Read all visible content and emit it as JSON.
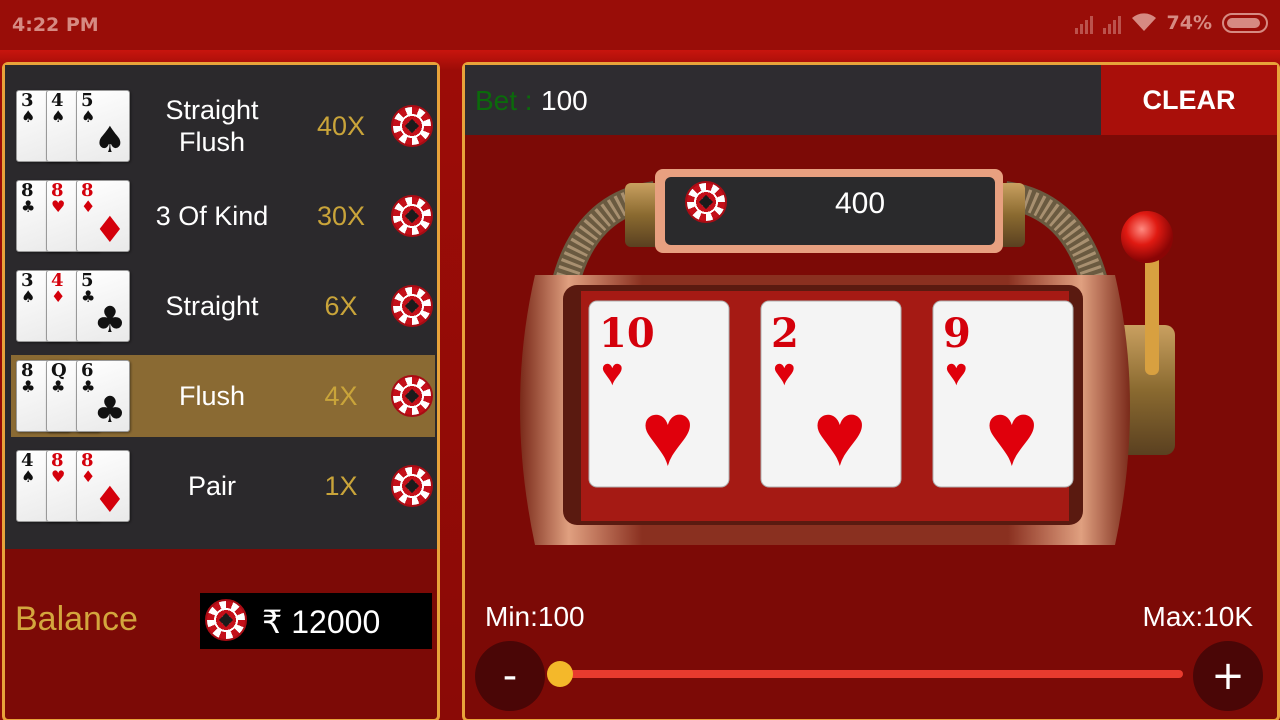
{
  "status_bar": {
    "time": "4:22 PM",
    "battery": "74%",
    "icons": [
      "signal-icon",
      "signal-icon",
      "wifi-icon",
      "battery-icon"
    ]
  },
  "paytable": {
    "rows": [
      {
        "name": "Straight Flush",
        "multiplier": "40X",
        "cards": [
          {
            "rank": "3",
            "suit": "♠",
            "color": "black"
          },
          {
            "rank": "4",
            "suit": "♠",
            "color": "black"
          },
          {
            "rank": "5",
            "suit": "♠",
            "color": "black"
          }
        ]
      },
      {
        "name": "3 Of Kind",
        "multiplier": "30X",
        "cards": [
          {
            "rank": "8",
            "suit": "♣",
            "color": "black"
          },
          {
            "rank": "8",
            "suit": "♥",
            "color": "red"
          },
          {
            "rank": "8",
            "suit": "♦",
            "color": "red"
          }
        ]
      },
      {
        "name": "Straight",
        "multiplier": "6X",
        "cards": [
          {
            "rank": "3",
            "suit": "♠",
            "color": "black"
          },
          {
            "rank": "4",
            "suit": "♦",
            "color": "red"
          },
          {
            "rank": "5",
            "suit": "♣",
            "color": "black"
          }
        ]
      },
      {
        "name": "Flush",
        "multiplier": "4X",
        "active": true,
        "cards": [
          {
            "rank": "8",
            "suit": "♣",
            "color": "black"
          },
          {
            "rank": "Q",
            "suit": "♣",
            "color": "black"
          },
          {
            "rank": "6",
            "suit": "♣",
            "color": "black"
          }
        ]
      },
      {
        "name": "Pair",
        "multiplier": "1X",
        "cards": [
          {
            "rank": "4",
            "suit": "♠",
            "color": "black"
          },
          {
            "rank": "8",
            "suit": "♥",
            "color": "red"
          },
          {
            "rank": "8",
            "suit": "♦",
            "color": "red"
          }
        ]
      }
    ]
  },
  "balance": {
    "label": "Balance",
    "value": "₹ 12000"
  },
  "bet": {
    "label": "Bet :",
    "value": "100",
    "clear_label": "CLEAR"
  },
  "machine": {
    "pot": "400",
    "reels": [
      {
        "rank": "10",
        "suit": "♥"
      },
      {
        "rank": "2",
        "suit": "♥"
      },
      {
        "rank": "9",
        "suit": "♥"
      }
    ]
  },
  "slider": {
    "min_label": "Min:100",
    "max_label": "Max:10K",
    "minus_label": "-",
    "plus_label": "+",
    "fraction": 0.0
  },
  "colors": {
    "background": "#8a0a06",
    "panel_border": "#e8a33a",
    "multiplier": "#c9a43a",
    "bet_label": "#0b6a0b",
    "active_row": "#8a6a33",
    "slider_track": "#e83b2e",
    "slider_thumb": "#f4b82a"
  }
}
